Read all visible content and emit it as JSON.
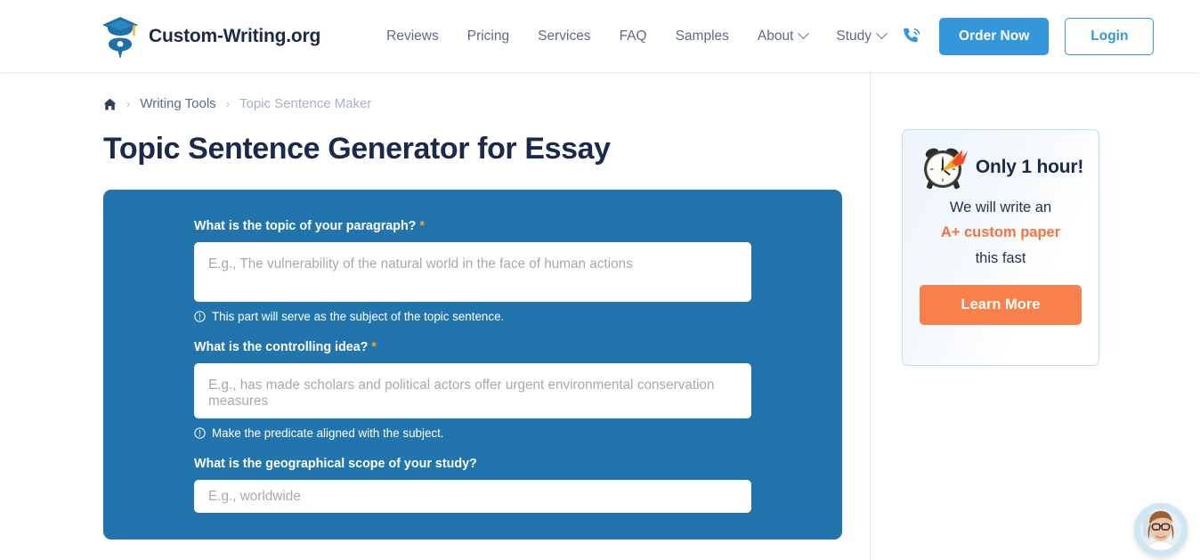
{
  "header": {
    "brand_name": "Custom-Writing.org",
    "logo_icon": "graduation-cap-pen-nib-logo",
    "nav": [
      {
        "label": "Reviews",
        "has_dropdown": false
      },
      {
        "label": "Pricing",
        "has_dropdown": false
      },
      {
        "label": "Services",
        "has_dropdown": false
      },
      {
        "label": "FAQ",
        "has_dropdown": false
      },
      {
        "label": "Samples",
        "has_dropdown": false
      },
      {
        "label": "About",
        "has_dropdown": true
      },
      {
        "label": "Study",
        "has_dropdown": true
      }
    ],
    "phone_icon": "phone-call-icon",
    "order_button": "Order Now",
    "login_button": "Login"
  },
  "breadcrumb": {
    "home_icon": "home-icon",
    "separator": "›",
    "items": [
      {
        "label": "Writing Tools",
        "current": false
      },
      {
        "label": "Topic Sentence Maker",
        "current": true
      }
    ]
  },
  "main": {
    "page_title": "Topic Sentence Generator for Essay",
    "form": {
      "background_color": "#2175ac",
      "fields": [
        {
          "label": "What is the topic of your paragraph?",
          "required": true,
          "required_marker": "*",
          "placeholder": "E.g., The vulnerability of the natural world in the face of human actions",
          "hint": "This part will serve as the subject of the topic sentence.",
          "hint_icon": "info-circle-icon"
        },
        {
          "label": "What is the controlling idea?",
          "required": true,
          "required_marker": "*",
          "placeholder": "E.g., has made scholars and political actors offer urgent environmental conservation measures",
          "hint": "Make the predicate aligned with the subject.",
          "hint_icon": "info-circle-icon"
        },
        {
          "label": "What is the geographical scope of your study?",
          "required": false,
          "required_marker": "",
          "placeholder": "E.g., worldwide",
          "hint": "",
          "hint_icon": ""
        }
      ]
    }
  },
  "sidebar": {
    "promo": {
      "icon": "alarm-clock-fire-icon",
      "headline": "Only 1 hour!",
      "line1": "We will write an",
      "accent": "A+ custom paper",
      "line2": "this fast",
      "accent_color": "#f2733f",
      "button_label": "Learn More",
      "button_color": "#f9804a"
    }
  },
  "chat": {
    "widget_icon": "support-agent-avatar"
  }
}
